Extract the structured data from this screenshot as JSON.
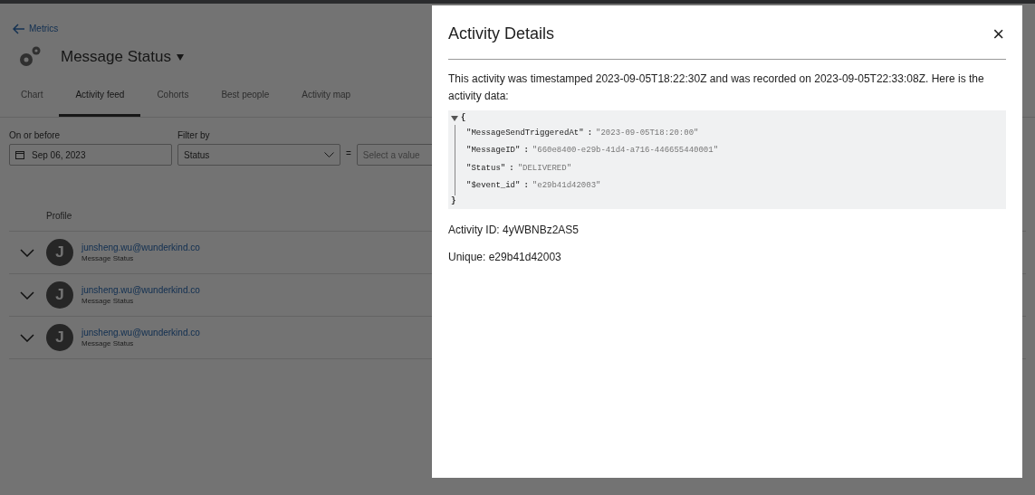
{
  "back_link": "Metrics",
  "page_title": "Message Status",
  "tabs": [
    {
      "label": "Chart",
      "selected": false
    },
    {
      "label": "Activity feed",
      "selected": true
    },
    {
      "label": "Cohorts",
      "selected": false
    },
    {
      "label": "Best people",
      "selected": false
    },
    {
      "label": "Activity map",
      "selected": false
    }
  ],
  "filters": {
    "date_label": "On or before",
    "date_value": "Sep 06, 2023",
    "filter_label": "Filter by",
    "filter_value": "Status",
    "operator": "=",
    "value_placeholder": "Select a value"
  },
  "table": {
    "columns": [
      "Profile"
    ],
    "rows": [
      {
        "avatar": "J",
        "email": "junsheng.wu@wunderkind.co",
        "event": "Message Status"
      },
      {
        "avatar": "J",
        "email": "junsheng.wu@wunderkind.co",
        "event": "Message Status"
      },
      {
        "avatar": "J",
        "email": "junsheng.wu@wunderkind.co",
        "event": "Message Status"
      }
    ]
  },
  "modal": {
    "title": "Activity Details",
    "close": "×",
    "description": "This activity was timestamped 2023-09-05T18:22:30Z and was recorded on 2023-09-05T22:33:08Z. Here is the activity data:",
    "json_viewer": {
      "expanded": true,
      "open_brace": "{",
      "close_brace": "}",
      "entries": [
        {
          "key": "\"MessageSendTriggeredAt\"",
          "separator": ":",
          "value": "\"2023-09-05T18:20:00\""
        },
        {
          "key": "\"MessageID\"",
          "separator": ":",
          "value": "\"660e8400-e29b-41d4-a716-446655440001\""
        },
        {
          "key": "\"Status\"",
          "separator": ":",
          "value": "\"DELIVERED\""
        },
        {
          "key": "\"$event_id\"",
          "separator": ":",
          "value": "\"e29b41d42003\""
        }
      ]
    },
    "activity_id": "Activity ID: 4yWBNBz2AS5",
    "unique": "Unique: e29b41d42003"
  }
}
